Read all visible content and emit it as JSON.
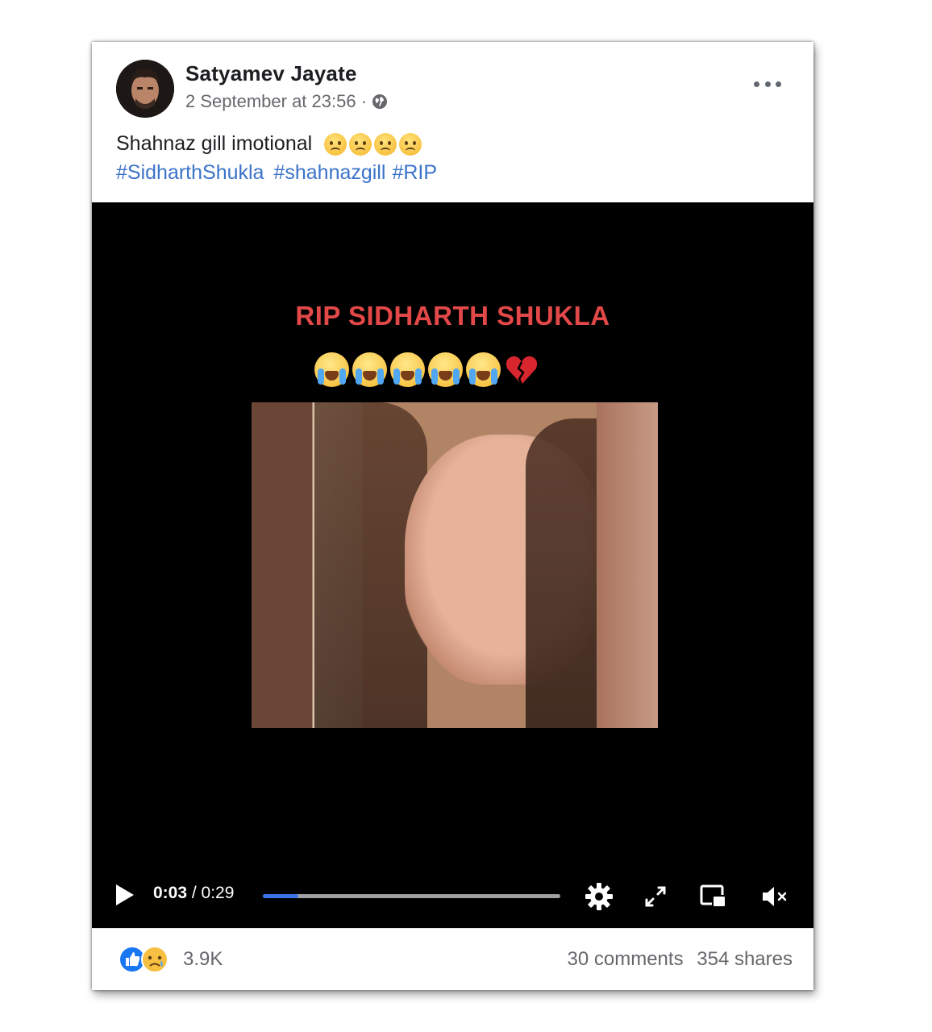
{
  "post": {
    "author": "Satyamev Jayate",
    "timestamp": "2 September at 23:56 ·",
    "text": "Shahnaz gill imotional",
    "text_emoji_count": 4,
    "hashtags": [
      "#SidharthShukla",
      "#shahnazgill",
      "#RIP"
    ]
  },
  "video": {
    "overlay_title": "RIP SIDHARTH SHUKLA",
    "current_time": "0:03",
    "separator": " / ",
    "duration": "0:29",
    "progress_fraction": 0.12,
    "controls": [
      "play-icon",
      "settings-icon",
      "fullscreen-icon",
      "picture-in-picture-icon",
      "mute-icon"
    ]
  },
  "footer": {
    "reaction_count": "3.9K",
    "comments": "30 comments",
    "shares": "354 shares",
    "reaction_icons": [
      "like-icon",
      "sad-icon"
    ]
  },
  "colors": {
    "link": "#3b73c9",
    "progress": "#3b73e8",
    "overlay_title": "#e24848"
  }
}
